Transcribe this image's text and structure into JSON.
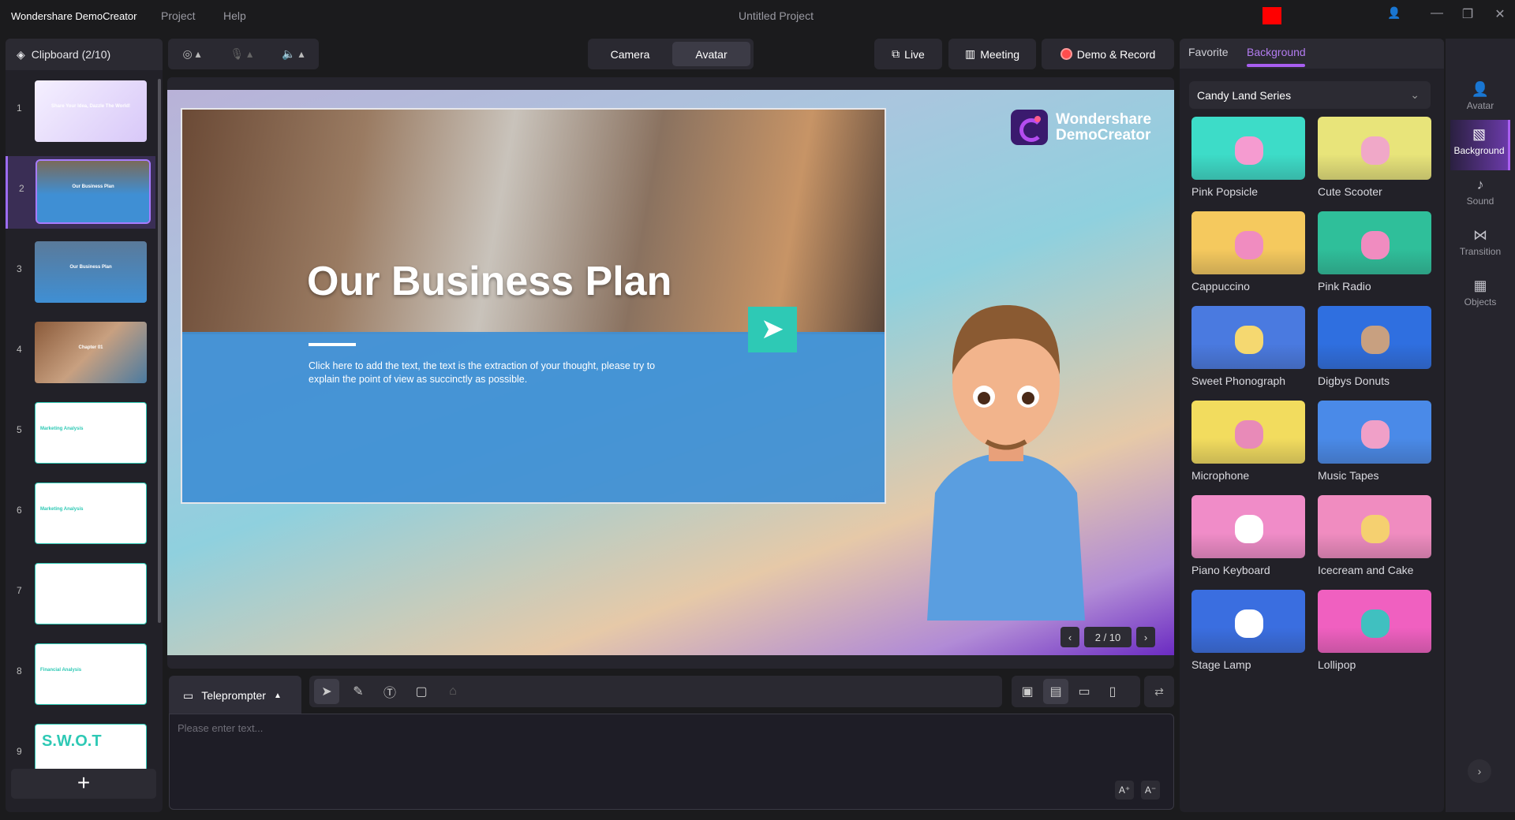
{
  "app": {
    "name": "Wondershare DemoCreator",
    "menu": [
      "Project",
      "Help"
    ],
    "title": "Untitled Project"
  },
  "clipboard": {
    "title": "Clipboard (2/10)",
    "slides": [
      {
        "num": "1",
        "label": "Share Your Idea, Dazzle The World!"
      },
      {
        "num": "2",
        "label": "Our Business Plan"
      },
      {
        "num": "3",
        "label": "Our Business Plan"
      },
      {
        "num": "4",
        "label": "Chapter 01"
      },
      {
        "num": "5",
        "label": "Marketing Analysis"
      },
      {
        "num": "6",
        "label": "Marketing Analysis"
      },
      {
        "num": "7",
        "label": ""
      },
      {
        "num": "8",
        "label": "Financial Analysis"
      },
      {
        "num": "9",
        "label": "S.W.O.T"
      }
    ],
    "selected_index": 1,
    "add_label": "+"
  },
  "toolbar": {
    "camera": "Camera",
    "avatar": "Avatar",
    "live": "Live",
    "meeting": "Meeting",
    "demo_record": "Demo & Record"
  },
  "slide": {
    "title": "Our Business Plan",
    "body": "Click here to add the text, the text is the extraction of your thought, please try to explain the point of view as succinctly as possible.",
    "logo_line1": "Wondershare",
    "logo_line2": "DemoCreator",
    "page": "2 / 10"
  },
  "bottom": {
    "teleprompter": "Teleprompter",
    "placeholder": "Please enter text...",
    "font_up": "A⁺",
    "font_down": "A⁻"
  },
  "right": {
    "tabs": [
      "Favorite",
      "Background"
    ],
    "active_tab": "Background",
    "series": "Candy Land Series",
    "backgrounds": [
      {
        "name": "Pink Popsicle",
        "color": "#3ddcc8",
        "accent": "#f59bd0"
      },
      {
        "name": "Cute Scooter",
        "color": "#e8e47a",
        "accent": "#f0a8c8"
      },
      {
        "name": "Cappuccino",
        "color": "#f5c95e",
        "accent": "#f08cc0"
      },
      {
        "name": "Pink Radio",
        "color": "#2fbf9a",
        "accent": "#f08cc0"
      },
      {
        "name": "Sweet Phonograph",
        "color": "#4a7ae0",
        "accent": "#f5d870"
      },
      {
        "name": "Digbys Donuts",
        "color": "#2f6fe0",
        "accent": "#c8a080"
      },
      {
        "name": "Microphone",
        "color": "#f2dc5e",
        "accent": "#e88ab8"
      },
      {
        "name": "Music Tapes",
        "color": "#4a8ae8",
        "accent": "#f0a0c8"
      },
      {
        "name": "Piano Keyboard",
        "color": "#f08cc8",
        "accent": "#ffffff"
      },
      {
        "name": "Icecream and Cake",
        "color": "#f08cc0",
        "accent": "#f5d070"
      },
      {
        "name": "Stage Lamp",
        "color": "#3a6ee0",
        "accent": "#ffffff"
      },
      {
        "name": "Lollipop",
        "color": "#f060c0",
        "accent": "#40c0c0"
      }
    ]
  },
  "sidebar": [
    {
      "label": "Avatar",
      "icon": "👤"
    },
    {
      "label": "Background",
      "icon": "▧"
    },
    {
      "label": "Sound",
      "icon": "♪"
    },
    {
      "label": "Transition",
      "icon": "⋈"
    },
    {
      "label": "Objects",
      "icon": "▦"
    }
  ],
  "sidebar_active": "Background",
  "colors": {
    "accent": "#a85ef0",
    "record": "#ff4d4d",
    "teal": "#2ec9b5"
  }
}
